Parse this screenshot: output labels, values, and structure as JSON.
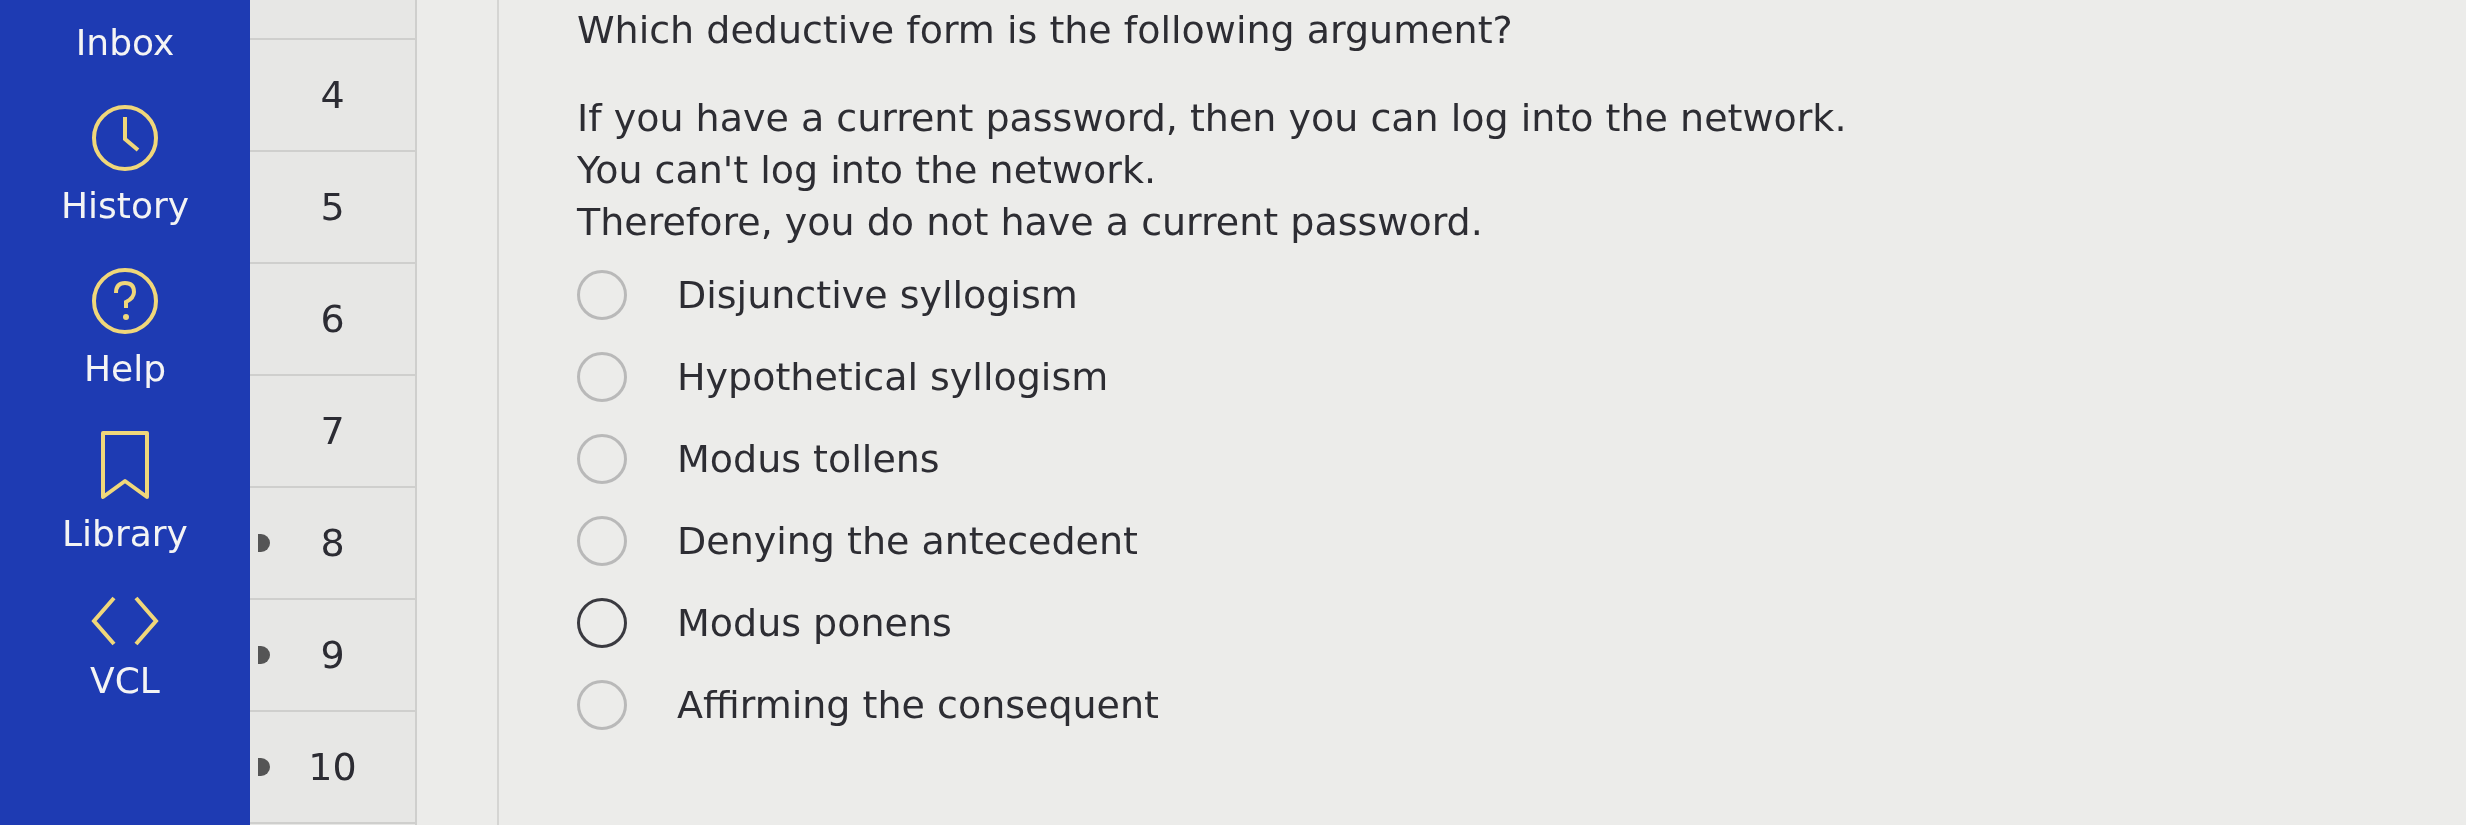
{
  "sidebar": {
    "items": [
      {
        "label": "Inbox",
        "kind": "plain"
      },
      {
        "label": "History",
        "kind": "clock"
      },
      {
        "label": "Help",
        "kind": "help"
      },
      {
        "label": "Library",
        "kind": "bookmark"
      },
      {
        "label": "VCL",
        "kind": "code"
      }
    ]
  },
  "question_nav": [
    {
      "number": "4",
      "marked": false
    },
    {
      "number": "5",
      "marked": false
    },
    {
      "number": "6",
      "marked": false
    },
    {
      "number": "7",
      "marked": false
    },
    {
      "number": "8",
      "marked": true
    },
    {
      "number": "9",
      "marked": true
    },
    {
      "number": "10",
      "marked": true
    }
  ],
  "question": {
    "prompt": "Which deductive form is the following argument?",
    "argument": [
      "If you have a current password, then you can log into the network.",
      "You can't log into the network.",
      "Therefore, you do not have a current password."
    ],
    "options": [
      {
        "label": "Disjunctive syllogism",
        "hovered": false
      },
      {
        "label": "Hypothetical syllogism",
        "hovered": false
      },
      {
        "label": "Modus tollens",
        "hovered": false
      },
      {
        "label": "Denying the antecedent",
        "hovered": false
      },
      {
        "label": "Modus ponens",
        "hovered": true
      },
      {
        "label": "Affirming the consequent",
        "hovered": false
      }
    ]
  }
}
